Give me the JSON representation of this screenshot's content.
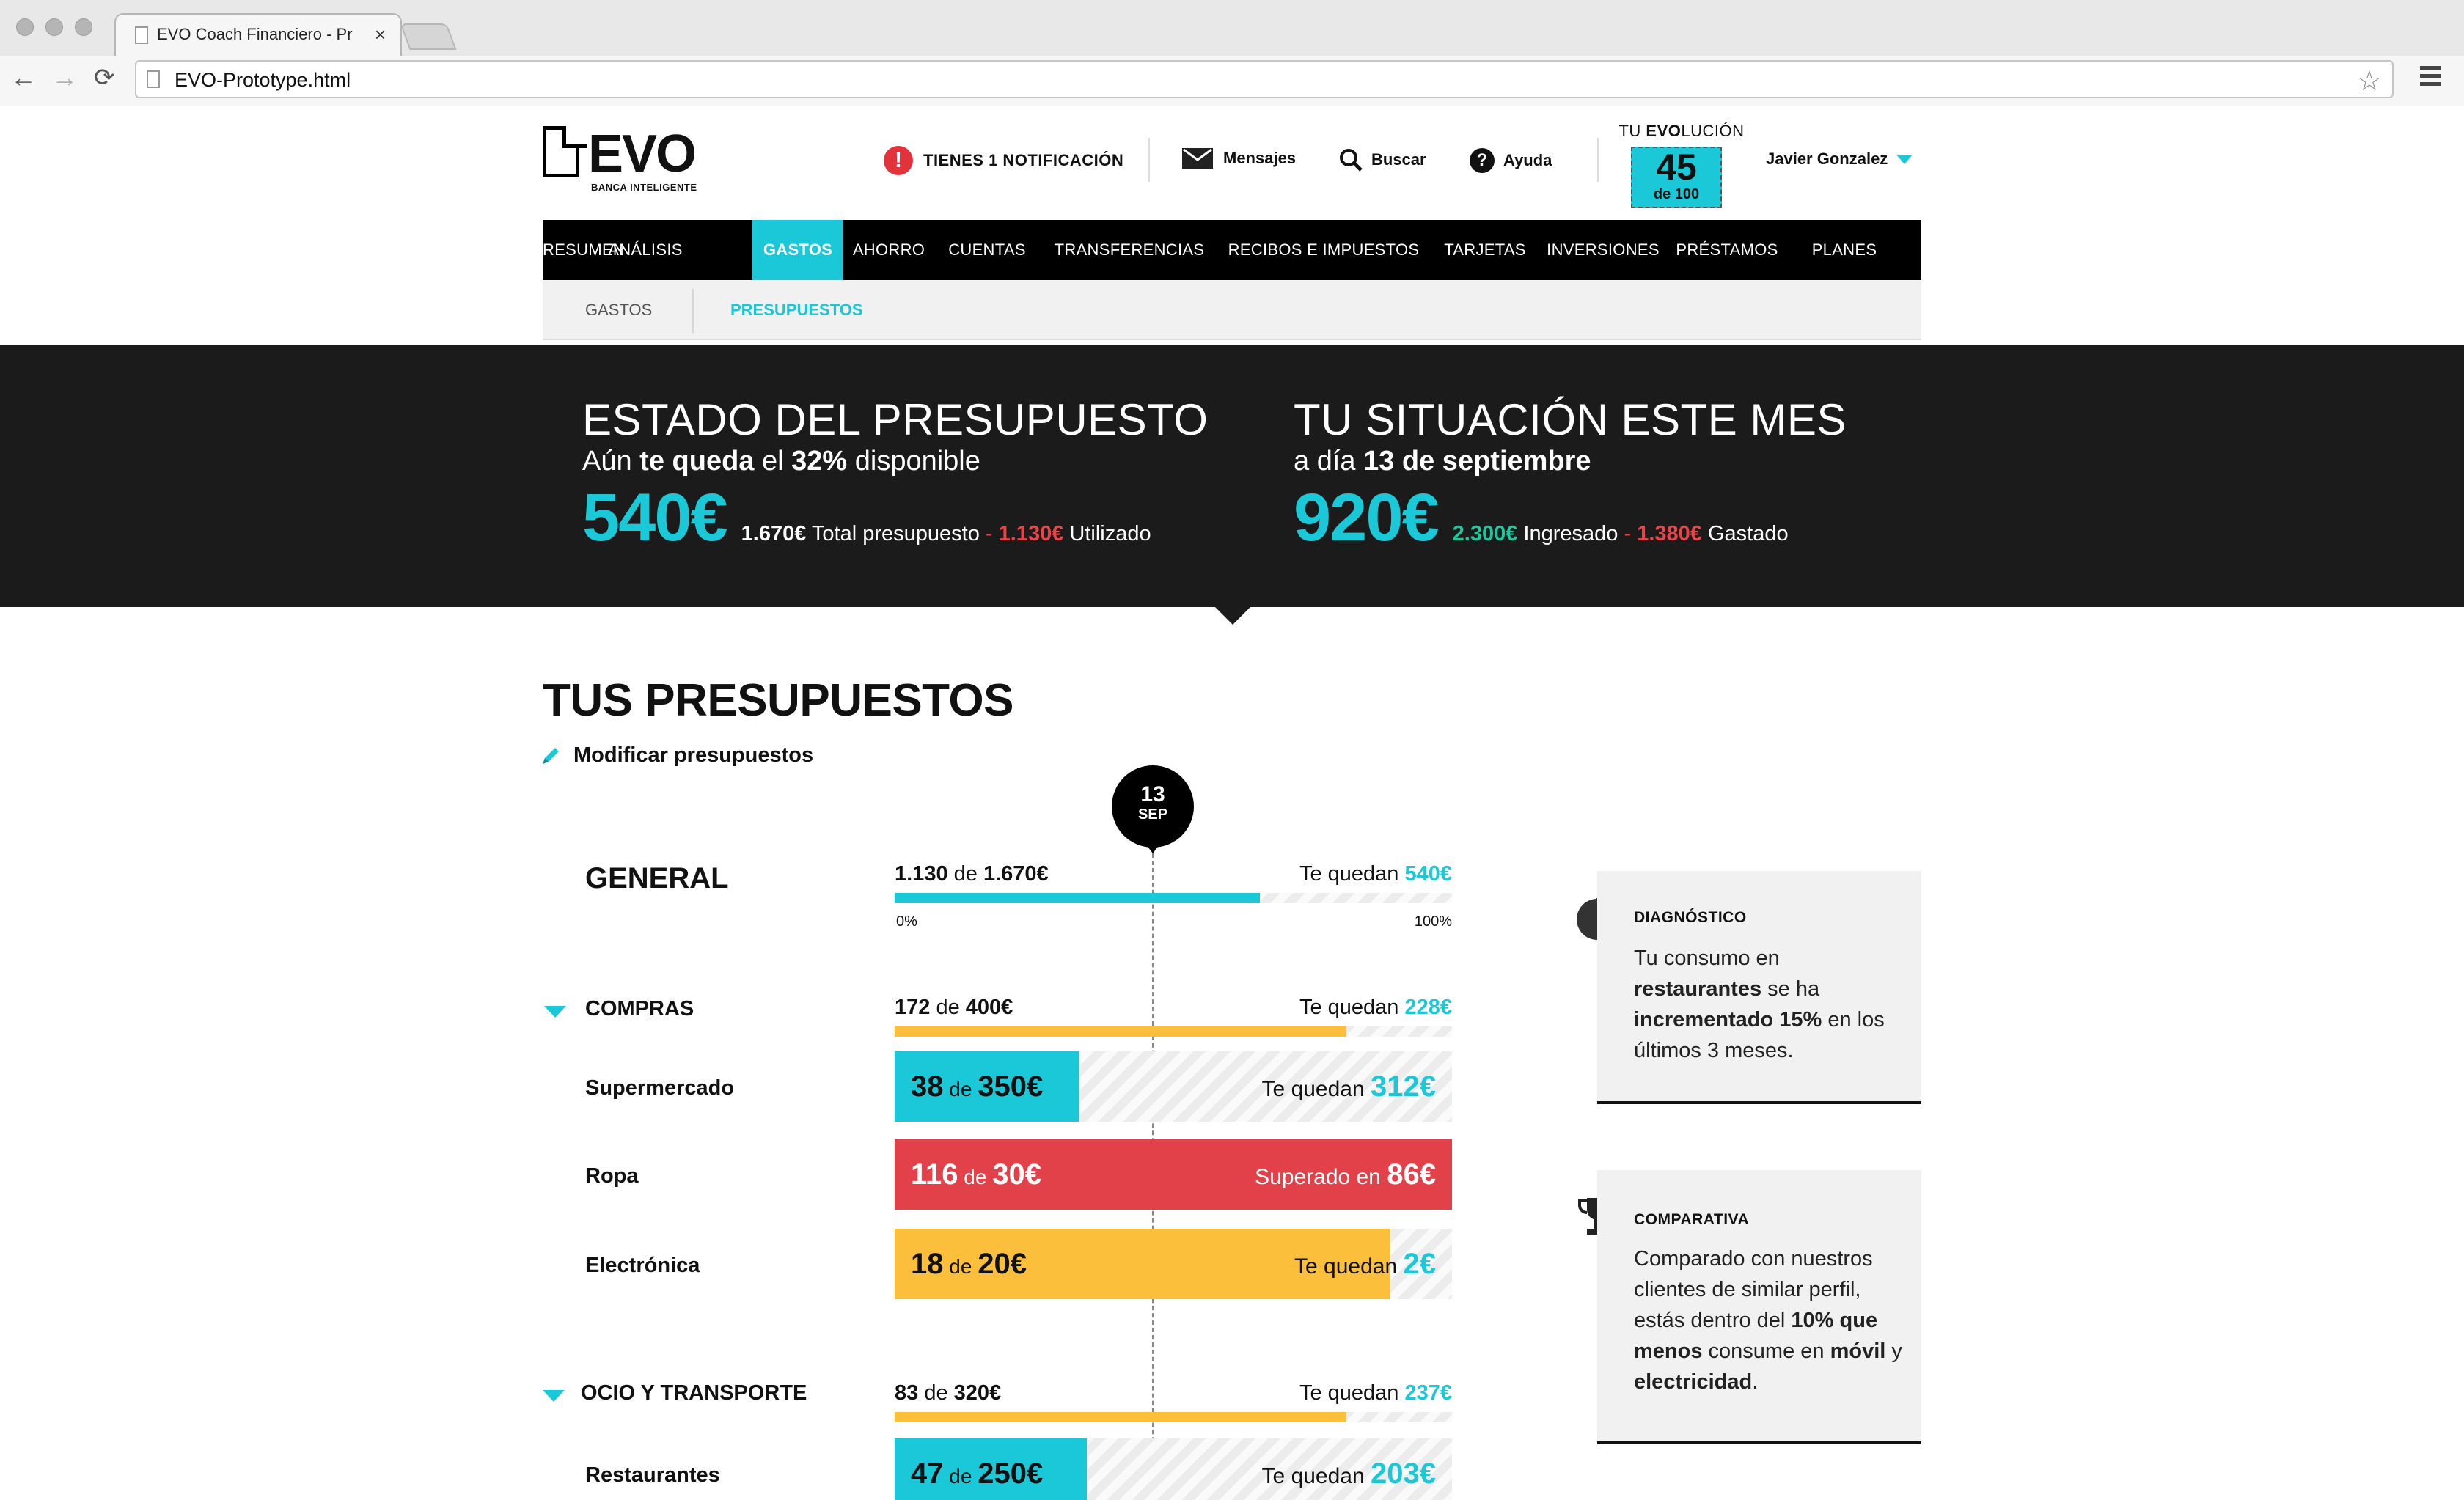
{
  "browser": {
    "tab_title": "EVO Coach Financiero - Pr",
    "tab_close": "×",
    "url": "EVO-Prototype.html",
    "back": "←",
    "forward": "→",
    "reload": "⟳",
    "star": "☆"
  },
  "header": {
    "logo_text": "EVO",
    "logo_tagline": "BANCA INTELIGENTE",
    "notification": "TIENES 1 NOTIFICACIÓN",
    "notification_icon": "!",
    "messages": "Mensajes",
    "search": "Buscar",
    "search_icon": "🔍",
    "help": "Ayuda",
    "help_icon": "?",
    "evolution_label_pre": "TU ",
    "evolution_label_bold": "EVO",
    "evolution_label_post": "LUCIÓN",
    "evolution_score": "45",
    "evolution_of": "de 100",
    "user_name": "Javier Gonzalez"
  },
  "nav": {
    "items": [
      "RESUMEN",
      "ANÁLISIS",
      "GASTOS",
      "AHORRO",
      "CUENTAS",
      "TRANSFERENCIAS",
      "RECIBOS E IMPUESTOS",
      "TARJETAS",
      "INVERSIONES",
      "PRÉSTAMOS",
      "PLANES"
    ],
    "active": "GASTOS",
    "sub_items": [
      "GASTOS",
      "PRESUPUESTOS"
    ],
    "sub_active": "PRESUPUESTOS"
  },
  "banner": {
    "left": {
      "title": "ESTADO DEL PRESUPUESTO",
      "sub_1": "Aún ",
      "sub_2": "te queda",
      "sub_3": " el ",
      "sub_4": "32%",
      "sub_5": " disponible",
      "amount": "540€",
      "total": "1.670€",
      "total_label": " Total presupuesto",
      "dash": " - ",
      "used": "1.130€",
      "used_label": " Utilizado"
    },
    "right": {
      "title": "TU SITUACIÓN ESTE MES",
      "sub_1": "a día ",
      "sub_2": "13 de septiembre",
      "amount": "920€",
      "income": "2.300€",
      "income_label": " Ingresado",
      "dash": " - ",
      "spent": "1.380€",
      "spent_label": " Gastado"
    }
  },
  "budgets": {
    "title": "TUS PRESUPUESTOS",
    "modify": "Modificar presupuestos",
    "today_day": "13",
    "today_month": "SEP",
    "remain_label": "Te quedan ",
    "of_label": " de ",
    "general": {
      "label": "GENERAL",
      "spent": "1.130",
      "total": "1.670€",
      "remaining": "540€",
      "fraction": 0.655,
      "axis_start": "0%",
      "axis_end": "100%"
    },
    "groups": [
      {
        "label": "COMPRAS",
        "spent": "172",
        "total": "400€",
        "remaining": "228€",
        "fraction": 0.81,
        "items": [
          {
            "label": "Supermercado",
            "spent": "38",
            "total": "350€",
            "status_label": "Te quedan ",
            "status_value": "312€",
            "fraction": 0.33,
            "color": "#1ac8d8"
          },
          {
            "label": "Ropa",
            "spent": "116",
            "total": "30€",
            "status_label": "Superado en ",
            "status_value": "86€",
            "fraction": 1.0,
            "color": "#e2414a"
          },
          {
            "label": "Electrónica",
            "spent": "18",
            "total": "20€",
            "status_label": "Te quedan ",
            "status_value": "2€",
            "fraction": 0.89,
            "color": "#fbbf3c"
          }
        ]
      },
      {
        "label": "OCIO Y TRANSPORTE",
        "spent": "83",
        "total": "320€",
        "remaining": "237€",
        "fraction": 0.81,
        "items": [
          {
            "label": "Restaurantes",
            "spent": "47",
            "total": "250€",
            "status_label": "Te quedan ",
            "status_value": "203€",
            "fraction": 0.345,
            "color": "#1ac8d8"
          }
        ]
      }
    ]
  },
  "cards": {
    "diagnostico": {
      "title": "DIAGNÓSTICO",
      "icon": "pie-chart-icon",
      "t1": "Tu consumo en ",
      "t2": "restaurantes",
      "t3": " se ha ",
      "t4": "incrementado 15%",
      "t5": " en los últimos 3 meses."
    },
    "comparativa": {
      "title": "COMPARATIVA",
      "icon": "trophy-icon",
      "t1": "Comparado con nuestros clientes de similar perfil, estás dentro del ",
      "t2": "10% que menos",
      "t3": " consume en ",
      "t4": "móvil",
      "t5": " y ",
      "t6": "electricidad",
      "t7": "."
    }
  },
  "colors": {
    "accent": "#1ac8d8",
    "over": "#e2414a",
    "warn": "#fbbf3c",
    "dark": "#1b1b1b"
  }
}
